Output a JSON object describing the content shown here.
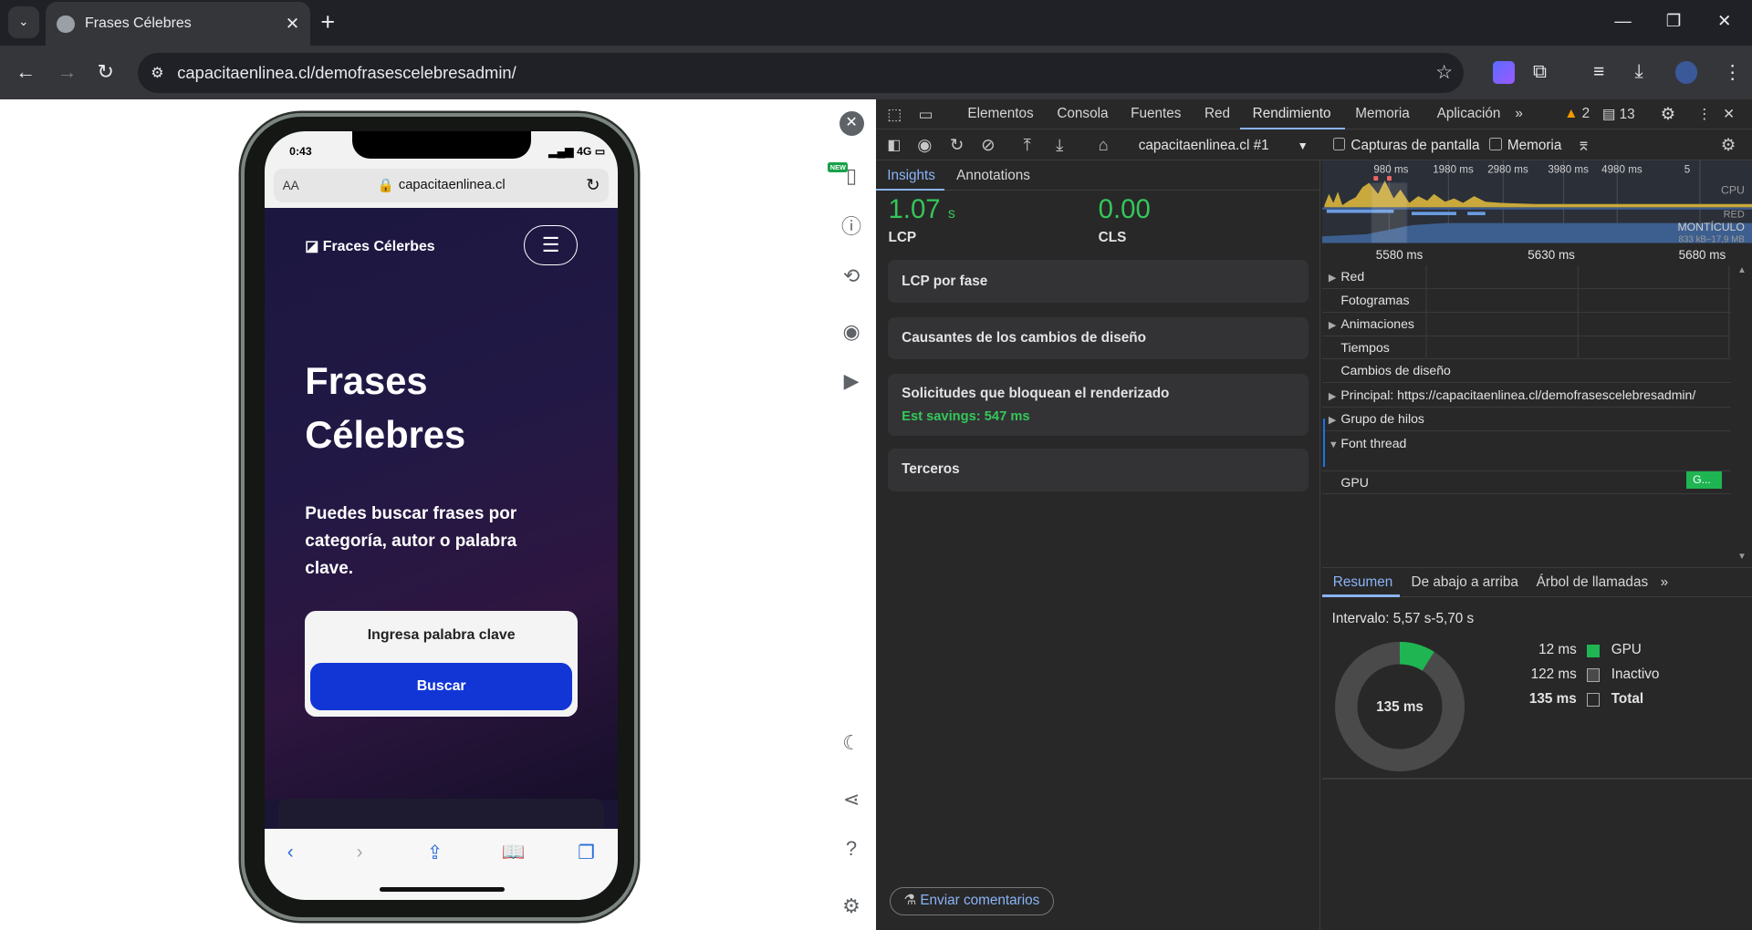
{
  "browser": {
    "tab_title": "Frases Célebres",
    "url": "capacitaenlinea.cl/demofrasescelebresadmin/"
  },
  "phone": {
    "time": "0:43",
    "signal": "4G",
    "aa": "AA",
    "url": "capacitaenlinea.cl",
    "brand": "Fraces Célerbes",
    "title": "Frases Célebres",
    "lead": "Puedes buscar frases por categoría, autor o palabra clave.",
    "search_placeholder": "Ingresa palabra clave",
    "search_button": "Buscar"
  },
  "emulator": {
    "new_badge": "NEW"
  },
  "devtools": {
    "tabs": [
      "Elementos",
      "Consola",
      "Fuentes",
      "Red",
      "Rendimiento",
      "Memoria",
      "Aplicación"
    ],
    "warnings": "2",
    "messages": "13",
    "recording": "capacitaenlinea.cl #1",
    "screenshots_label": "Capturas de pantalla",
    "memory_label": "Memoria",
    "left_tabs": [
      "Insights",
      "Annotations"
    ],
    "lcp_value": "1.07",
    "lcp_unit": "s",
    "lcp_label": "LCP",
    "cls_value": "0.00",
    "cls_label": "CLS",
    "insights": [
      {
        "title": "LCP por fase",
        "sub": ""
      },
      {
        "title": "Causantes de los cambios de diseño",
        "sub": ""
      },
      {
        "title": "Solicitudes que bloquean el renderizado",
        "sub": "Est savings: 547 ms"
      },
      {
        "title": "Terceros",
        "sub": ""
      }
    ],
    "feedback": "Enviar comentarios",
    "overview_ticks": [
      "980 ms",
      "1980 ms",
      "2980 ms",
      "3980 ms",
      "4980 ms",
      "5"
    ],
    "overview_labels": {
      "cpu": "CPU",
      "net": "RED",
      "heap": "MONTÍCULO",
      "heap_range": "833 kB–17,9 MB"
    },
    "ruler": [
      "5580 ms",
      "5630 ms",
      "5680 ms"
    ],
    "tracks": [
      {
        "label": "Red",
        "arrow": "▶"
      },
      {
        "label": "Fotogramas",
        "arrow": ""
      },
      {
        "label": "Animaciones",
        "arrow": "▶"
      },
      {
        "label": "Tiempos",
        "arrow": ""
      },
      {
        "label": "Cambios de diseño",
        "arrow": ""
      },
      {
        "label": "Principal: https://capacitaenlinea.cl/demofrasescelebresadmin/",
        "arrow": "▶"
      },
      {
        "label": "Grupo de hilos",
        "arrow": "▶"
      },
      {
        "label": "Font thread",
        "arrow": "▼"
      },
      {
        "label": "GPU",
        "arrow": ""
      }
    ],
    "gpu_block": "G...",
    "bottom_tabs": [
      "Resumen",
      "De abajo a arriba",
      "Árbol de llamadas"
    ],
    "interval": "Intervalo: 5,57 s-5,70 s",
    "donut_total": "135 ms",
    "summary": [
      {
        "value": "12 ms",
        "label": "GPU",
        "color": "#1fb552"
      },
      {
        "value": "122 ms",
        "label": "Inactivo",
        "color": "#4a4a4a"
      },
      {
        "value": "135 ms",
        "label": "Total",
        "color": "#282828"
      }
    ],
    "gpu_fraction": 0.089
  }
}
